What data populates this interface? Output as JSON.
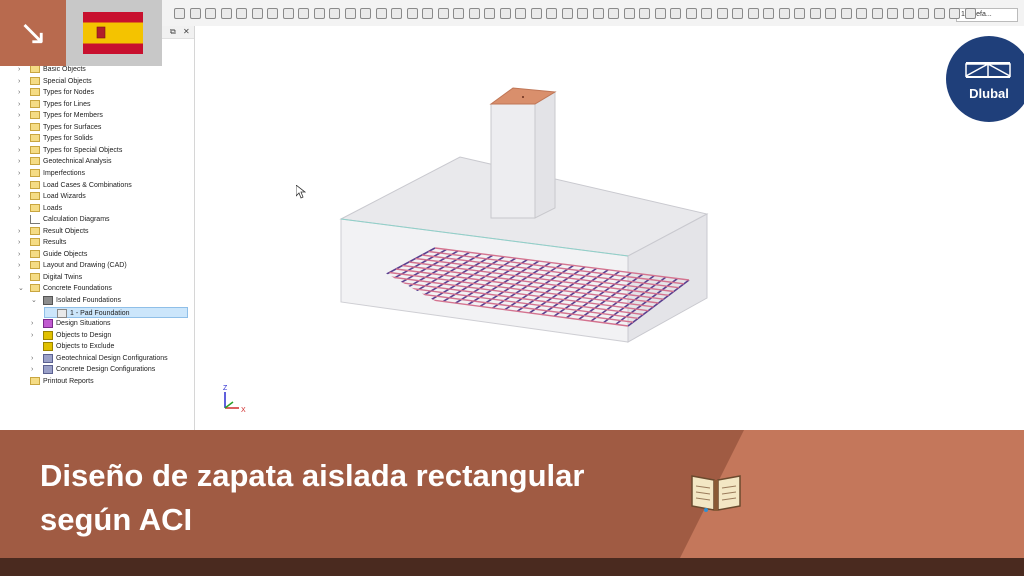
{
  "toolbar": {
    "combo_value": "1 - Defa..."
  },
  "navigator": {
    "items": [
      {
        "label": "Basic Objects"
      },
      {
        "label": "Special Objects"
      },
      {
        "label": "Types for Nodes"
      },
      {
        "label": "Types for Lines"
      },
      {
        "label": "Types for Members"
      },
      {
        "label": "Types for Surfaces"
      },
      {
        "label": "Types for Solids"
      },
      {
        "label": "Types for Special Objects"
      },
      {
        "label": "Geotechnical Analysis"
      },
      {
        "label": "Imperfections"
      },
      {
        "label": "Load Cases & Combinations"
      },
      {
        "label": "Load Wizards"
      },
      {
        "label": "Loads"
      },
      {
        "label": "Calculation Diagrams"
      },
      {
        "label": "Result Objects"
      },
      {
        "label": "Results"
      },
      {
        "label": "Guide Objects"
      },
      {
        "label": "Layout and Drawing (CAD)"
      },
      {
        "label": "Digital Twins"
      },
      {
        "label": "Concrete Foundations"
      },
      {
        "label": "Isolated Foundations"
      },
      {
        "label": "1 - Pad Foundation"
      },
      {
        "label": "Design Situations"
      },
      {
        "label": "Objects to Design"
      },
      {
        "label": "Objects to Exclude"
      },
      {
        "label": "Geotechnical Design Configurations"
      },
      {
        "label": "Concrete Design Configurations"
      },
      {
        "label": "Printout Reports"
      }
    ]
  },
  "axes": {
    "z": "Z",
    "x": "X"
  },
  "brand": {
    "logo_text": "Dlubal",
    "flag": "spain-flag-icon",
    "arrow_icon": "arrow-down-right-icon"
  },
  "banner": {
    "title": "Diseño de zapata aislada rectangular según ACI",
    "book_icon": "book-icon"
  },
  "colors": {
    "banner": "#a05b43",
    "banner_light": "#c4775b",
    "dlubal_blue": "#1f3f7a",
    "rebar": "#5a3f8f",
    "column_top": "#d98f6c"
  }
}
